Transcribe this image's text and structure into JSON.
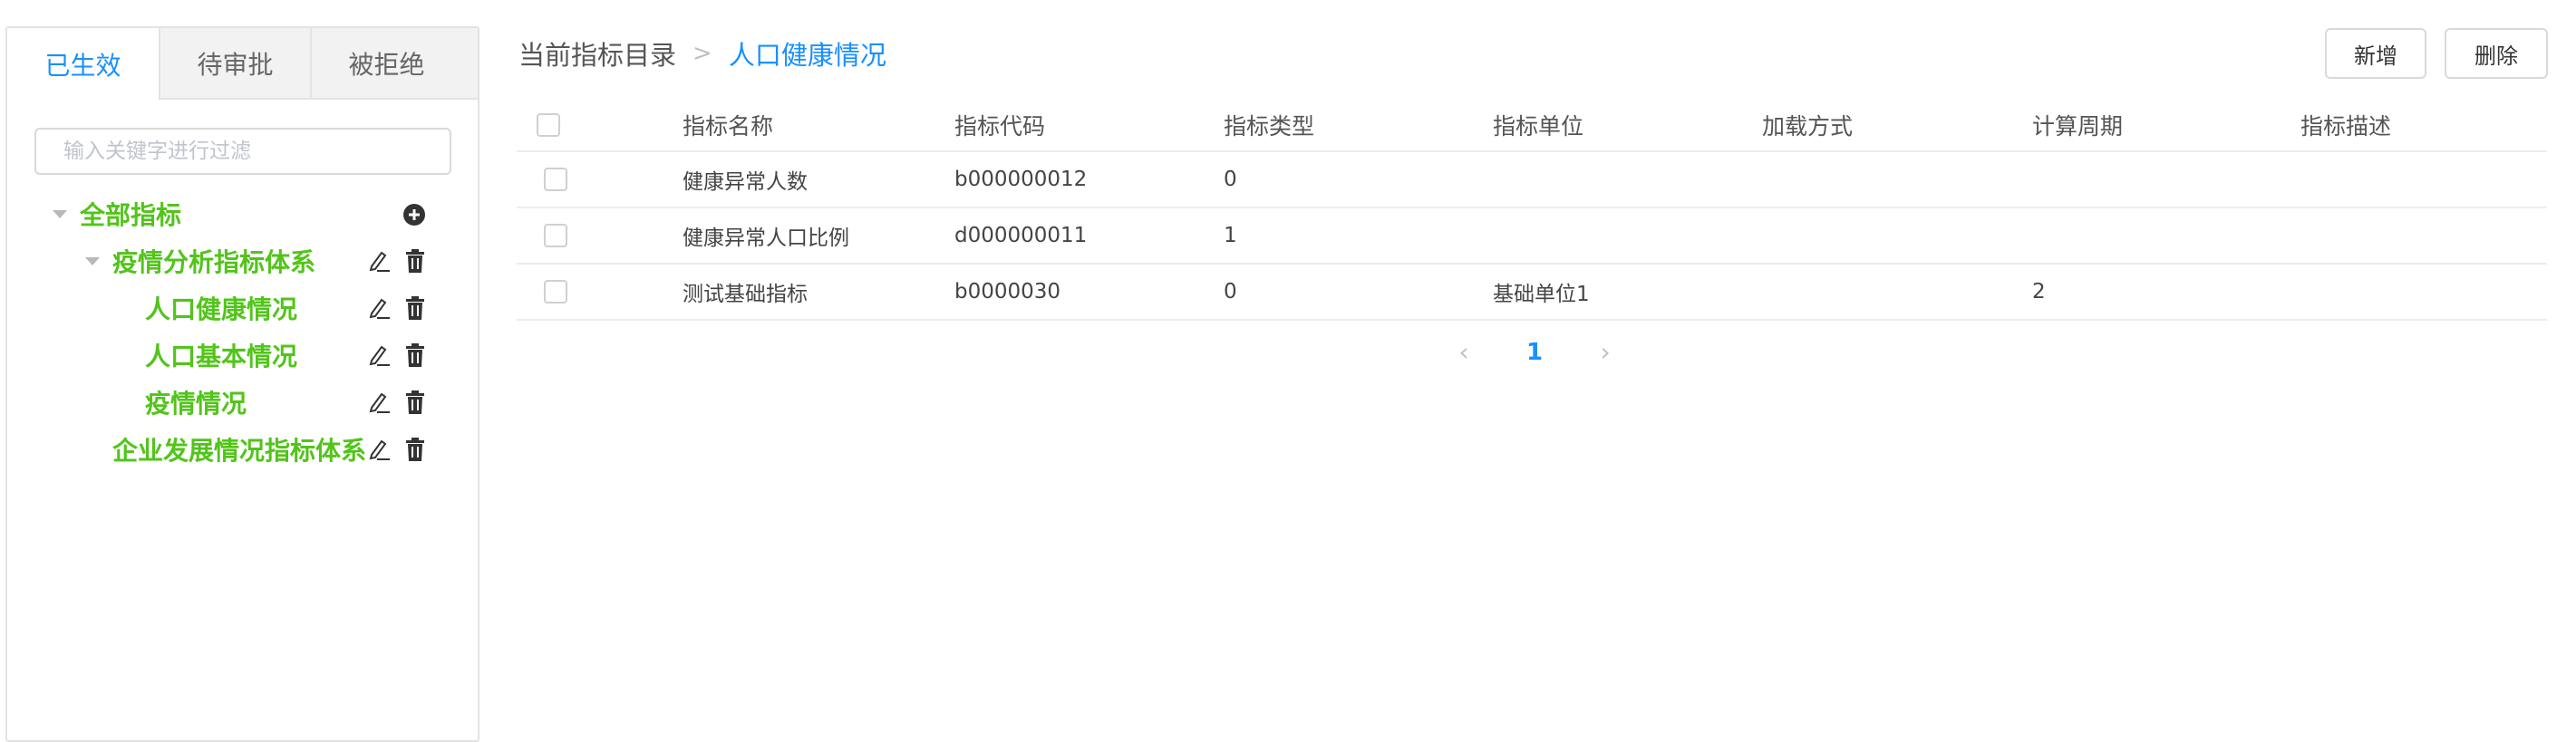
{
  "sidebar": {
    "tabs": [
      {
        "label": "已生效",
        "active": true
      },
      {
        "label": "待审批",
        "active": false
      },
      {
        "label": "被拒绝",
        "active": false
      }
    ],
    "filter": {
      "placeholder": "输入关键字进行过滤",
      "value": ""
    },
    "tree": [
      {
        "label": "全部指标",
        "level": 0,
        "expanded": true,
        "actions": [
          "plus-circle-icon"
        ]
      },
      {
        "label": "疫情分析指标体系",
        "level": 1,
        "expanded": true,
        "actions": [
          "edit-icon",
          "delete-icon"
        ]
      },
      {
        "label": "人口健康情况",
        "level": 2,
        "actions": [
          "edit-icon",
          "delete-icon"
        ]
      },
      {
        "label": "人口基本情况",
        "level": 2,
        "actions": [
          "edit-icon",
          "delete-icon"
        ]
      },
      {
        "label": "疫情情况",
        "level": 2,
        "actions": [
          "edit-icon",
          "delete-icon"
        ]
      },
      {
        "label": "企业发展情况指标体系",
        "level": 1,
        "actions": [
          "edit-icon",
          "delete-icon"
        ]
      }
    ]
  },
  "breadcrumb": {
    "root": "当前指标目录",
    "separator": ">",
    "current": "人口健康情况"
  },
  "toolbar": {
    "add_label": "新增",
    "delete_label": "删除"
  },
  "table": {
    "columns": [
      "指标名称",
      "指标代码",
      "指标类型",
      "指标单位",
      "加载方式",
      "计算周期",
      "指标描述"
    ],
    "rows": [
      [
        "健康异常人数",
        "b000000012",
        "0",
        "",
        "",
        "",
        ""
      ],
      [
        "健康异常人口比例",
        "d000000011",
        "1",
        "",
        "",
        "",
        ""
      ],
      [
        "测试基础指标",
        "b0000030",
        "0",
        "基础单位1",
        "",
        "2",
        ""
      ]
    ]
  },
  "pagination": {
    "current_page": "1",
    "prev_icon": "chevron-left-icon",
    "next_icon": "chevron-right-icon"
  },
  "colors": {
    "accent": "#1890ff",
    "tree_text": "#52c41a",
    "border": "#e3e3e3"
  }
}
